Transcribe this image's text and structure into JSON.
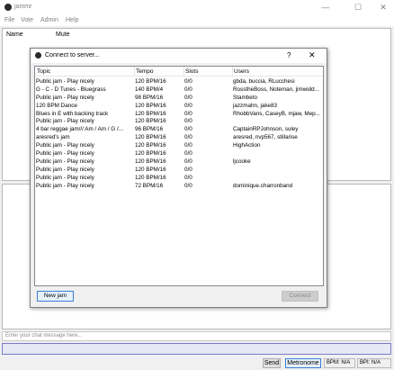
{
  "window": {
    "title": "jammr",
    "icon": "jammr-logo-icon",
    "controls": [
      "minimize-icon",
      "maximize-icon",
      "close-icon"
    ]
  },
  "menu": {
    "items": [
      "File",
      "Vote",
      "Admin",
      "Help"
    ]
  },
  "users_panel": {
    "columns": [
      "Name",
      "Mute"
    ]
  },
  "chat": {
    "placeholder": "Enter your chat message here..."
  },
  "status_bar": {
    "send_label": "Send",
    "metronome_label": "Metronome",
    "bpm_label": "BPM: N/A",
    "bpi_label": "BPI: N/A"
  },
  "dialog": {
    "title": "Connect to server...",
    "help_label": "?",
    "close_label": "✕",
    "columns": [
      "Topic",
      "Tempo",
      "Slots",
      "Users"
    ],
    "rows": [
      [
        "Public jam - Play nicely",
        "120 BPM/16",
        "0/0",
        "gbda, buccia, RLucchesi"
      ],
      [
        "G - C - D Tunes - Bluegrass",
        "140 BPM/4",
        "0/0",
        "RosstheBoss, Noteman, jimwidd..."
      ],
      [
        "Public jam - Play nicely",
        "98 BPM/16",
        "0/0",
        "Stambeto"
      ],
      [
        "120 BPM Dance",
        "120 BPM/16",
        "0/0",
        "jazzmahn, jake83"
      ],
      [
        "Blues in E with backing track",
        "120 BPM/16",
        "0/0",
        "RhobbVans, CaseyB, mjaw, Mep..."
      ],
      [
        "Public jam - Play nicely",
        "120 BPM/16",
        "0/0",
        ""
      ],
      [
        "4 bar reggae jam/// Am / Am / G /...",
        "96 BPM/16",
        "0/0",
        "CaptainRPJohnson, suley"
      ],
      [
        "aresred's jam",
        "120 BPM/16",
        "0/0",
        "aresred, nvp567, stillarise"
      ],
      [
        "Public jam - Play nicely",
        "120 BPM/16",
        "0/0",
        "HighAction"
      ],
      [
        "Public jam - Play nicely",
        "120 BPM/16",
        "0/0",
        ""
      ],
      [
        "Public jam - Play nicely",
        "120 BPM/16",
        "0/0",
        "ljcooke"
      ],
      [
        "Public jam - Play nicely",
        "120 BPM/16",
        "0/0",
        ""
      ],
      [
        "Public jam - Play nicely",
        "120 BPM/16",
        "0/0",
        ""
      ],
      [
        "Public jam - Play nicely",
        "72 BPM/16",
        "0/0",
        "dominique.charronband"
      ]
    ],
    "new_jam_label": "New jam",
    "connect_label": "Connect"
  }
}
